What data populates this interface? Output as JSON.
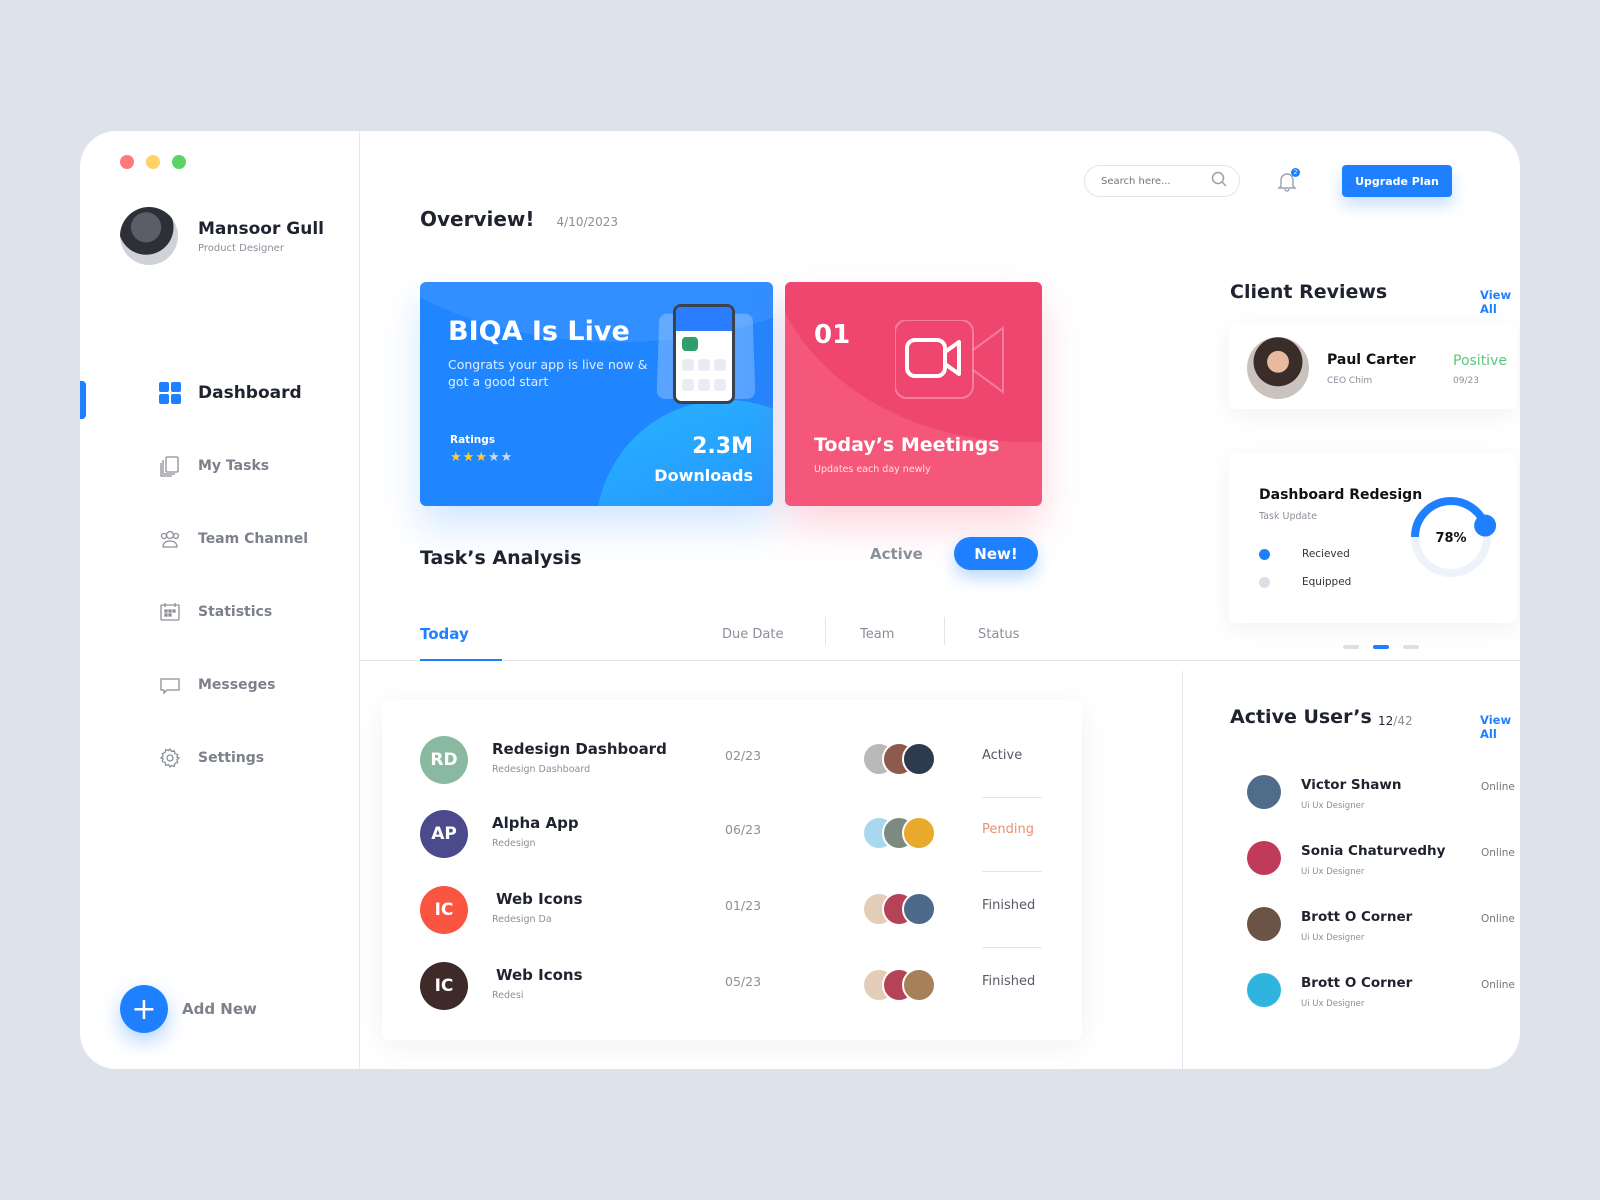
{
  "window": {
    "traffic_colors": [
      "#ff7a7a",
      "#ffd166",
      "#5ad467"
    ]
  },
  "profile": {
    "name": "Mansoor Gull",
    "role": "Product Designer"
  },
  "sidebar": {
    "items": [
      {
        "label": "Dashboard",
        "icon": "grid-icon",
        "active": true
      },
      {
        "label": "My Tasks",
        "icon": "documents-icon"
      },
      {
        "label": "Team Channel",
        "icon": "users-icon"
      },
      {
        "label": "Statistics",
        "icon": "calendar-icon"
      },
      {
        "label": "Messeges",
        "icon": "message-icon"
      },
      {
        "label": "Settings",
        "icon": "gear-icon"
      }
    ],
    "add_new": "Add New"
  },
  "topbar": {
    "search_placeholder": "Search here...",
    "notification_count": "2",
    "upgrade_label": "Upgrade Plan"
  },
  "overview": {
    "title": "Overview!",
    "date": "4/10/2023"
  },
  "live_card": {
    "title": "BIQA Is Live",
    "subtitle": "Congrats your app is live now & got a good start",
    "ratings_label": "Ratings",
    "rating": 3,
    "rating_max": 5,
    "downloads": "2.3M",
    "downloads_label": "Downloads"
  },
  "meetings_card": {
    "count": "01",
    "title": "Today’s Meetings",
    "subtitle": "Updates each day newly"
  },
  "tasks": {
    "title": "Task’s Analysis",
    "filter_active": "Active",
    "new_label": "New!",
    "tab_today": "Today",
    "columns": [
      "Due Date",
      "Team",
      "Status"
    ],
    "rows": [
      {
        "initials": "RD",
        "color": "#8ab9a1",
        "title": "Redesign Dashboard",
        "subtitle": "Redesign Dashboard",
        "due": "02/23",
        "status": "Active",
        "status_color": "#555a66"
      },
      {
        "initials": "AP",
        "color": "#4a4a8c",
        "title": "Alpha App",
        "subtitle": "Redesign",
        "due": "06/23",
        "status": "Pending",
        "status_color": "#e9906e"
      },
      {
        "initials": "IC",
        "color": "#fa5541",
        "title": "Web Icons",
        "subtitle": "Redesign Da",
        "due": "01/23",
        "status": "Finished",
        "status_color": "#555a66"
      },
      {
        "initials": "IC",
        "color": "#3f2a2a",
        "title": "Web Icons",
        "subtitle": "Redesi",
        "due": "05/23",
        "status": "Finished",
        "status_color": "#555a66"
      }
    ]
  },
  "client_reviews": {
    "title": "Client Reviews",
    "view_all": "View All",
    "review": {
      "name": "Paul Carter",
      "company": "CEO Chim",
      "sentiment": "Positive",
      "date": "09/23"
    }
  },
  "task_update": {
    "title": "Dashboard Redesign",
    "subtitle": "Task Update",
    "percent": 78,
    "percent_label": "78%",
    "legend": [
      {
        "label": "Recieved",
        "color": "#1f80ff"
      },
      {
        "label": "Equipped",
        "color": "#dcdfe6"
      }
    ],
    "pager_active": 2,
    "pager_total": 3
  },
  "active_users": {
    "title": "Active User’s",
    "count": "12",
    "total": "/42",
    "view_all": "View All",
    "users": [
      {
        "name": "Victor Shawn",
        "role": "Ui Ux Designer",
        "status": "Online",
        "avatar_color": "#4f6d8a"
      },
      {
        "name": "Sonia Chaturvedhy",
        "role": "Ui Ux Designer",
        "status": "Online",
        "avatar_color": "#c03a5a"
      },
      {
        "name": "Brott O Corner",
        "role": "Ui Ux Designer",
        "status": "Online",
        "avatar_color": "#6b5446"
      },
      {
        "name": "Brott O Corner",
        "role": "Ui Ux Designer",
        "status": "Online",
        "avatar_color": "#2fb4e0"
      }
    ]
  }
}
